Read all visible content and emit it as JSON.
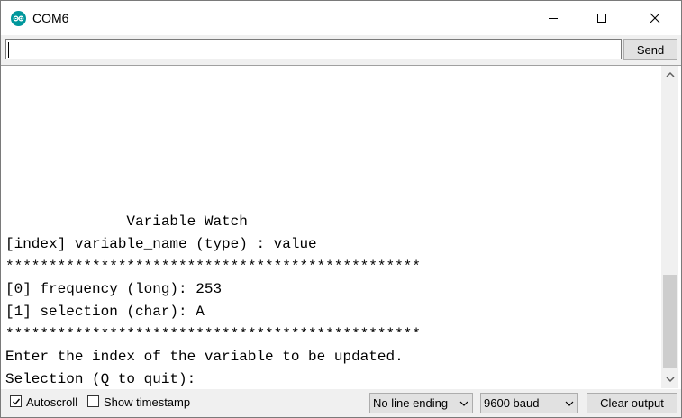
{
  "window": {
    "title": "COM6",
    "icon": "arduino-icon",
    "controls": [
      "minimize-icon",
      "maximize-icon",
      "close-icon"
    ]
  },
  "input": {
    "value": "",
    "placeholder": ""
  },
  "toolbar": {
    "send_label": "Send"
  },
  "output": {
    "lines": [
      "              Variable Watch",
      "[index] variable_name (type) : value",
      "************************************************",
      "[0] frequency (long): 253",
      "[1] selection (char): A",
      "************************************************",
      "Enter the index of the variable to be updated.",
      "Selection (Q to quit):"
    ]
  },
  "bottom": {
    "autoscroll_label": "Autoscroll",
    "autoscroll_checked": true,
    "timestamp_label": "Show timestamp",
    "timestamp_checked": false,
    "line_ending_value": "No line ending",
    "baud_value": "9600 baud",
    "clear_label": "Clear output"
  },
  "colors": {
    "arduino_teal": "#00979c",
    "chrome": "#f0f0f0",
    "button": "#e1e1e1"
  }
}
